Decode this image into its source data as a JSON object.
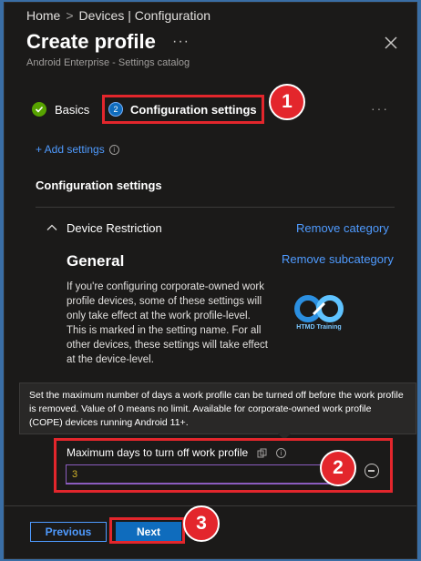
{
  "breadcrumb": {
    "home": "Home",
    "separator": ">",
    "current": "Devices | Configuration"
  },
  "header": {
    "title": "Create profile",
    "more": "···",
    "subtitle": "Android Enterprise - Settings catalog"
  },
  "steps": [
    {
      "label": "Basics",
      "state": "complete"
    },
    {
      "number": "2",
      "label": "Configuration settings",
      "state": "current"
    }
  ],
  "step_more": "···",
  "add_settings": "+ Add settings",
  "section_title": "Configuration settings",
  "category": {
    "label": "Device Restriction",
    "remove_category": "Remove category",
    "subcategory": "General",
    "remove_subcategory": "Remove subcategory",
    "description": "If you're configuring corporate-owned work profile devices, some of these settings will only take effect at the work profile-level. This is marked in the setting name. For all other devices, these settings will take effect at the device-level."
  },
  "logo_text": "HTMD Training",
  "tooltip": "Set the maximum number of days a work profile can be turned off before the work profile is removed. Value of 0 means no limit. Available for corporate-owned work profile (COPE) devices running Android 11+.",
  "setting": {
    "label": "Maximum days to turn off work profile",
    "value": "3"
  },
  "annotations": {
    "one": "1",
    "two": "2",
    "three": "3"
  },
  "footer": {
    "previous": "Previous",
    "next": "Next"
  },
  "colors": {
    "accent": "#4f9bff",
    "primary": "#0f6cbd",
    "highlight": "#e3262c",
    "success": "#57a300"
  }
}
